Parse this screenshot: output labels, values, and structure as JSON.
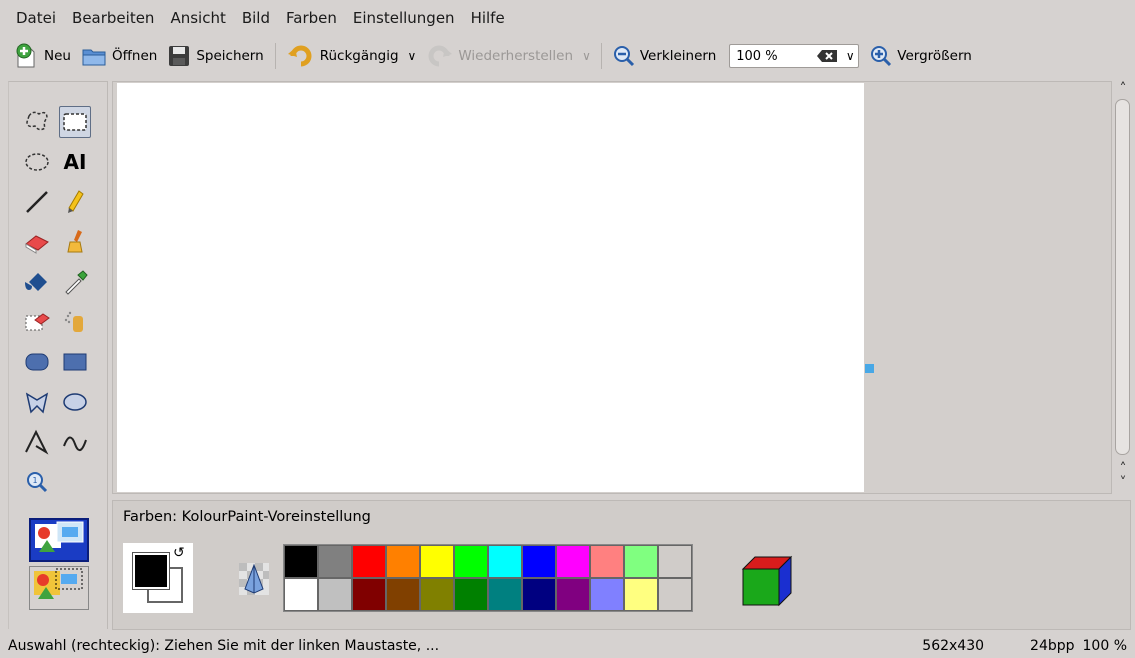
{
  "menubar": {
    "items": [
      {
        "label": "Datei"
      },
      {
        "label": "Bearbeiten"
      },
      {
        "label": "Ansicht"
      },
      {
        "label": "Bild"
      },
      {
        "label": "Farben"
      },
      {
        "label": "Einstellungen"
      },
      {
        "label": "Hilfe"
      }
    ]
  },
  "toolbar": {
    "new_label": "Neu",
    "open_label": "Öffnen",
    "save_label": "Speichern",
    "undo_label": "Rückgängig",
    "redo_label": "Wiederherstellen",
    "zoom_out_label": "Verkleinern",
    "zoom_value": "100 %",
    "zoom_in_label": "Vergrößern"
  },
  "tools": [
    {
      "name": "free-form-selection-icon"
    },
    {
      "name": "rectangular-selection-icon",
      "active": true
    },
    {
      "name": "elliptical-selection-icon"
    },
    {
      "name": "text-tool-icon",
      "text": "AI"
    },
    {
      "name": "line-tool-icon"
    },
    {
      "name": "pen-tool-icon"
    },
    {
      "name": "eraser-icon"
    },
    {
      "name": "brush-icon"
    },
    {
      "name": "flood-fill-icon"
    },
    {
      "name": "color-picker-icon"
    },
    {
      "name": "color-eraser-icon"
    },
    {
      "name": "spraycan-icon"
    },
    {
      "name": "rounded-rectangle-icon"
    },
    {
      "name": "rectangle-icon"
    },
    {
      "name": "polygon-icon"
    },
    {
      "name": "ellipse-icon"
    },
    {
      "name": "connected-lines-icon"
    },
    {
      "name": "curve-icon"
    },
    {
      "name": "zoom-tool-icon"
    }
  ],
  "colors": {
    "label": "Farben: KolourPaint-Voreinstellung",
    "foreground": "#000000",
    "background": "#ffffff",
    "palette_top": [
      "#000000",
      "#808080",
      "#ff0000",
      "#ff8000",
      "#ffff00",
      "#00ff00",
      "#00ffff",
      "#0000ff",
      "#ff00ff",
      "#ff8080",
      "#80ff80",
      "#d0ccc9"
    ],
    "palette_bottom": [
      "#ffffff",
      "#c0c0c0",
      "#800000",
      "#804000",
      "#808000",
      "#008000",
      "#008080",
      "#000080",
      "#800080",
      "#8080ff",
      "#ffff80",
      "#d0ccc9"
    ]
  },
  "status": {
    "message": "Auswahl (rechteckig): Ziehen Sie mit der linken Maustaste, ...",
    "dimensions": "562x430",
    "depth": "24bpp",
    "zoom": "100 %"
  },
  "accent": "#48a8e6"
}
